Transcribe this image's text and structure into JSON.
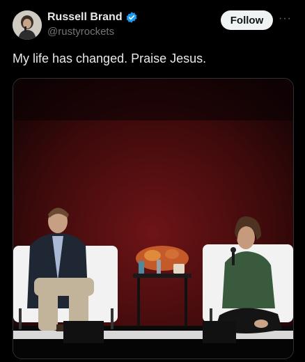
{
  "author": {
    "display_name": "Russell Brand",
    "handle": "@rustyrockets",
    "verified": true
  },
  "actions": {
    "follow_label": "Follow",
    "more_label": "···"
  },
  "tweet": {
    "text": "My life has changed. Praise Jesus."
  },
  "icons": {
    "verified": "verified-badge-icon",
    "more": "more-options-icon"
  },
  "colors": {
    "background": "#000000",
    "verified_blue": "#1d9bf0",
    "follow_bg": "#eff3f4",
    "stage_red": "#5a0f10"
  }
}
